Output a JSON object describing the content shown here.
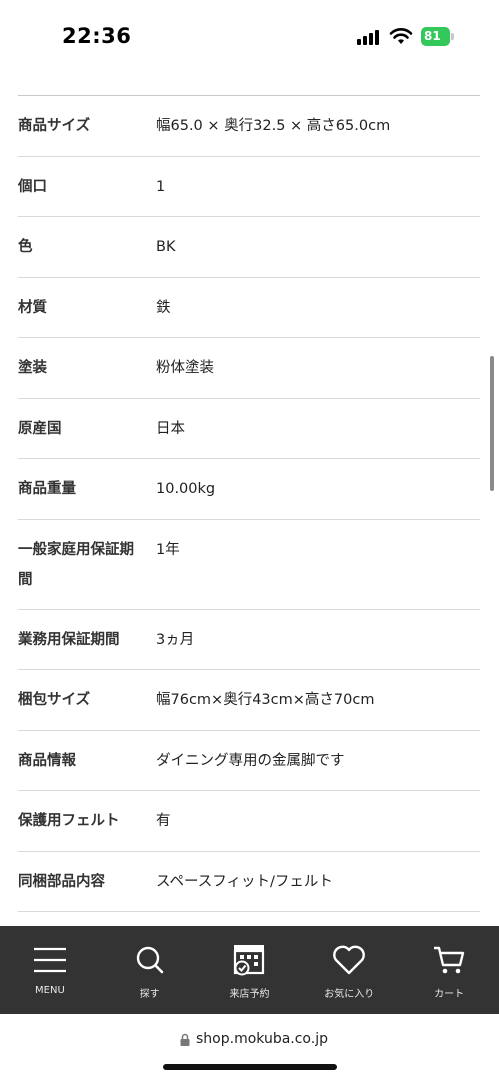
{
  "status_bar": {
    "time": "22:36",
    "battery": "81"
  },
  "spec_rows": [
    {
      "label": "商品サイズ",
      "value": "幅65.0 × 奥行32.5 × 高さ65.0cm"
    },
    {
      "label": "個口",
      "value": "1"
    },
    {
      "label": "色",
      "value": "BK"
    },
    {
      "label": "材質",
      "value": "鉄"
    },
    {
      "label": "塗装",
      "value": "粉体塗装"
    },
    {
      "label": "原産国",
      "value": "日本"
    },
    {
      "label": "商品重量",
      "value": "10.00kg"
    },
    {
      "label_line1": "一般家庭用保証期",
      "label_line2": "間",
      "value": "1年"
    },
    {
      "label": "業務用保証期間",
      "value": "3ヵ月"
    },
    {
      "label": "梱包サイズ",
      "value": "幅76cm×奥行43cm×高さ70cm"
    },
    {
      "label": "商品情報",
      "value": "ダイニング専用の金属脚です"
    },
    {
      "label": "保護用フェルト",
      "value": "有"
    },
    {
      "label": "同梱部品内容",
      "value": "スペースフィット/フェルト"
    }
  ],
  "bottom_nav": [
    {
      "label": "MENU",
      "icon": "menu-icon"
    },
    {
      "label": "探す",
      "icon": "search-icon"
    },
    {
      "label": "来店予約",
      "icon": "store-booking-icon"
    },
    {
      "label": "お気に入り",
      "icon": "heart-icon"
    },
    {
      "label": "カート",
      "icon": "cart-icon"
    }
  ],
  "url_bar": {
    "url": "shop.mokuba.co.jp"
  },
  "colors": {
    "nav_background": "#333333",
    "battery_green": "#34c759"
  }
}
